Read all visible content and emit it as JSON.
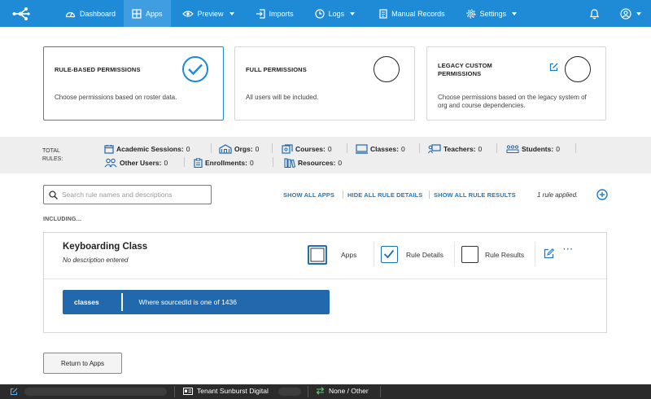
{
  "nav": {
    "items": [
      {
        "label": "Dashboard",
        "icon": "dashboard-icon"
      },
      {
        "label": "Apps",
        "icon": "apps-icon",
        "active": true
      },
      {
        "label": "Preview",
        "icon": "eye-icon",
        "dropdown": true
      },
      {
        "label": "Imports",
        "icon": "import-icon"
      },
      {
        "label": "Logs",
        "icon": "clock-icon",
        "dropdown": true
      },
      {
        "label": "Manual Records",
        "icon": "document-icon"
      },
      {
        "label": "Settings",
        "icon": "gear-icon",
        "dropdown": true
      }
    ],
    "right": [
      "bell-icon",
      "user-icon"
    ]
  },
  "permission_cards": [
    {
      "title": "RULE-BASED PERMISSIONS",
      "description": "Choose permissions based on roster data.",
      "selected": true
    },
    {
      "title": "FULL PERMISSIONS",
      "description": "All users will be included.",
      "selected": false
    },
    {
      "title": "LEGACY CUSTOM PERMISSIONS",
      "description": "Choose permissions based on the legacy system of org and course dependencies.",
      "selected": false
    }
  ],
  "total_rules": {
    "label": "TOTAL RULES:",
    "stats": [
      {
        "label": "Academic Sessions:",
        "count": "0",
        "icon": "calendar-icon"
      },
      {
        "label": "Orgs:",
        "count": "0",
        "icon": "school-icon"
      },
      {
        "label": "Courses:",
        "count": "0",
        "icon": "course-icon"
      },
      {
        "label": "Classes:",
        "count": "0",
        "icon": "monitor-icon"
      },
      {
        "label": "Teachers:",
        "count": "0",
        "icon": "teacher-icon"
      },
      {
        "label": "Students:",
        "count": "0",
        "icon": "students-icon"
      },
      {
        "label": "Other Users:",
        "count": "0",
        "icon": "users-icon"
      },
      {
        "label": "Enrollments:",
        "count": "0",
        "icon": "clipboard-icon"
      },
      {
        "label": "Resources:",
        "count": "0",
        "icon": "books-icon"
      }
    ]
  },
  "search": {
    "placeholder": "Search rule names and descriptions",
    "value": ""
  },
  "toolbar": {
    "show_all_apps": "SHOW ALL APPS",
    "hide_all_rule_details": "HIDE ALL RULE DETAILS",
    "show_all_rule_results": "SHOW ALL RULE RESULTS",
    "applied": "1 rule applied."
  },
  "including_label": "INCLUDING...",
  "rule": {
    "title": "Keyboarding Class",
    "description": "No description entered",
    "toggles": [
      {
        "label": "Apps",
        "checked": false,
        "focused": true
      },
      {
        "label": "Rule Details",
        "checked": true
      },
      {
        "label": "Rule Results",
        "checked": false
      }
    ],
    "more": "···",
    "condition": {
      "key": "classes",
      "value": "Where sourcedId is one of 1436"
    }
  },
  "return_button": "Return to Apps",
  "statusbar": {
    "tenant": "Tenant Sunburst Digital",
    "sync": "None / Other"
  },
  "colors": {
    "brand": "#1f8ad6",
    "chip": "#2268ad",
    "link": "#1f7ac4",
    "statusbar": "#2b2b2b"
  }
}
